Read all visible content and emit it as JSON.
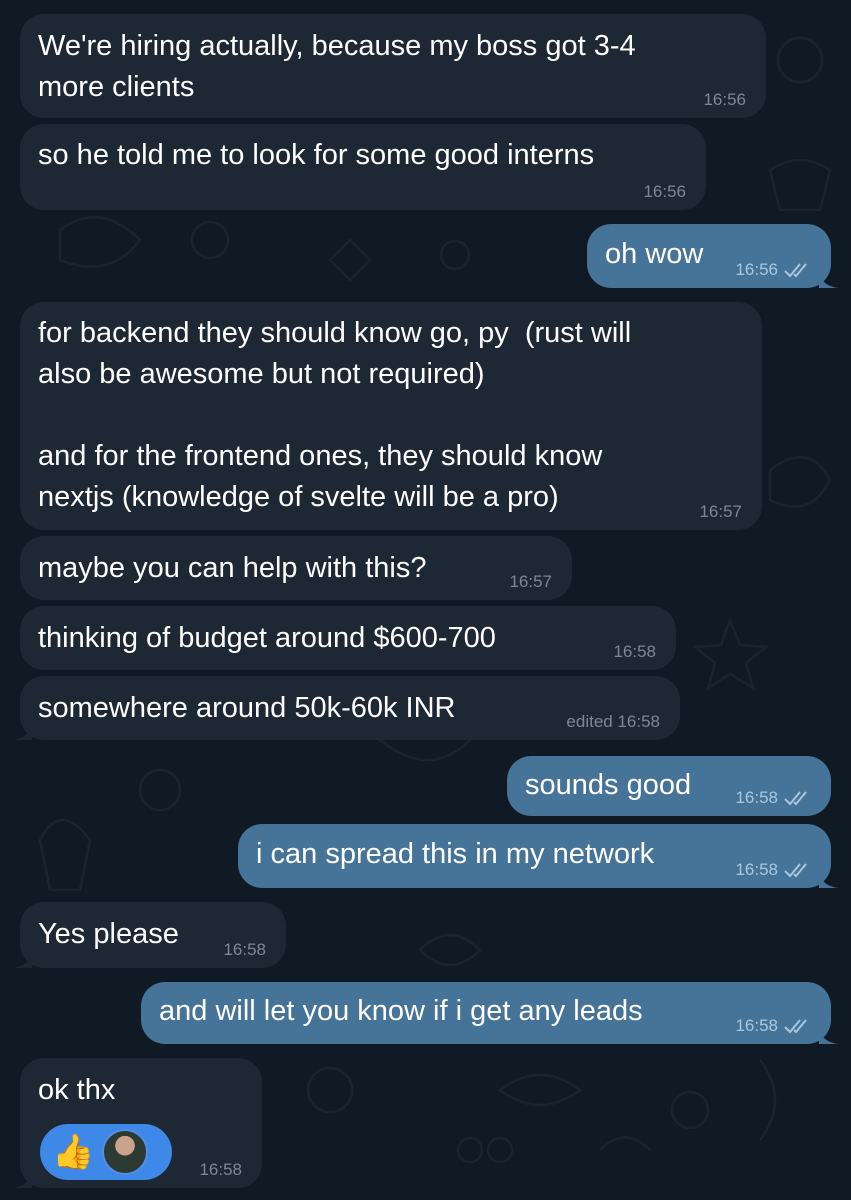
{
  "colors": {
    "background": "#0f1a24",
    "incoming_bubble": "#1d2834",
    "outgoing_bubble": "#467398",
    "reaction_pill": "#3e88e7",
    "incoming_time": "#7d8894",
    "outgoing_time": "#a9c7e0"
  },
  "messages": [
    {
      "from": "them",
      "text": "We're hiring actually, because my boss got 3-4\nmore clients",
      "time": "16:56"
    },
    {
      "from": "them",
      "text": "so he told me to look for some good interns",
      "time": "16:56"
    },
    {
      "from": "me",
      "text": "oh wow",
      "time": "16:56",
      "status": "read"
    },
    {
      "from": "them",
      "text": "for backend they should know go, py  (rust will\nalso be awesome but not required)\n\nand for the frontend ones, they should know\nnextjs (knowledge of svelte will be a pro)",
      "time": "16:57"
    },
    {
      "from": "them",
      "text": "maybe you can help with this?",
      "time": "16:57"
    },
    {
      "from": "them",
      "text": "thinking of budget around $600-700",
      "time": "16:58"
    },
    {
      "from": "them",
      "text": "somewhere around 50k-60k INR",
      "time": "edited 16:58"
    },
    {
      "from": "me",
      "text": "sounds good",
      "time": "16:58",
      "status": "read"
    },
    {
      "from": "me",
      "text": "i can spread this in my network",
      "time": "16:58",
      "status": "read"
    },
    {
      "from": "them",
      "text": "Yes please",
      "time": "16:58"
    },
    {
      "from": "me",
      "text": "and will let you know if i get any leads",
      "time": "16:58",
      "status": "read"
    },
    {
      "from": "them",
      "text": "ok thx",
      "time": "16:58",
      "reaction": {
        "emoji": "👍",
        "icon": "thumbs-up-icon",
        "reactor": "user-avatar"
      }
    }
  ]
}
